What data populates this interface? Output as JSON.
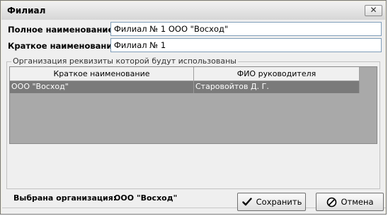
{
  "window": {
    "title": "Филиал",
    "close_glyph": "✕"
  },
  "form": {
    "full_name_label": "Полное наименование",
    "full_name_value": "Филиал № 1 ООО \"Восход\"",
    "short_name_label": "Краткое наименование",
    "short_name_value": "Филиал № 1"
  },
  "org_group": {
    "legend": "Организация реквизиты которой будут использованы",
    "columns": [
      "Краткое наименование",
      "ФИО руководителя"
    ],
    "rows": [
      {
        "short_name": "ООО \"Восход\"",
        "director": "Старовойтов Д. Г."
      }
    ],
    "selected_label": "Выбрана организация:",
    "selected_value": "ООО \"Восход\""
  },
  "buttons": {
    "save_label": "Сохранить",
    "save_icon": "checkmark-icon",
    "cancel_label": "Отмена",
    "cancel_icon": "cancel-icon"
  }
}
